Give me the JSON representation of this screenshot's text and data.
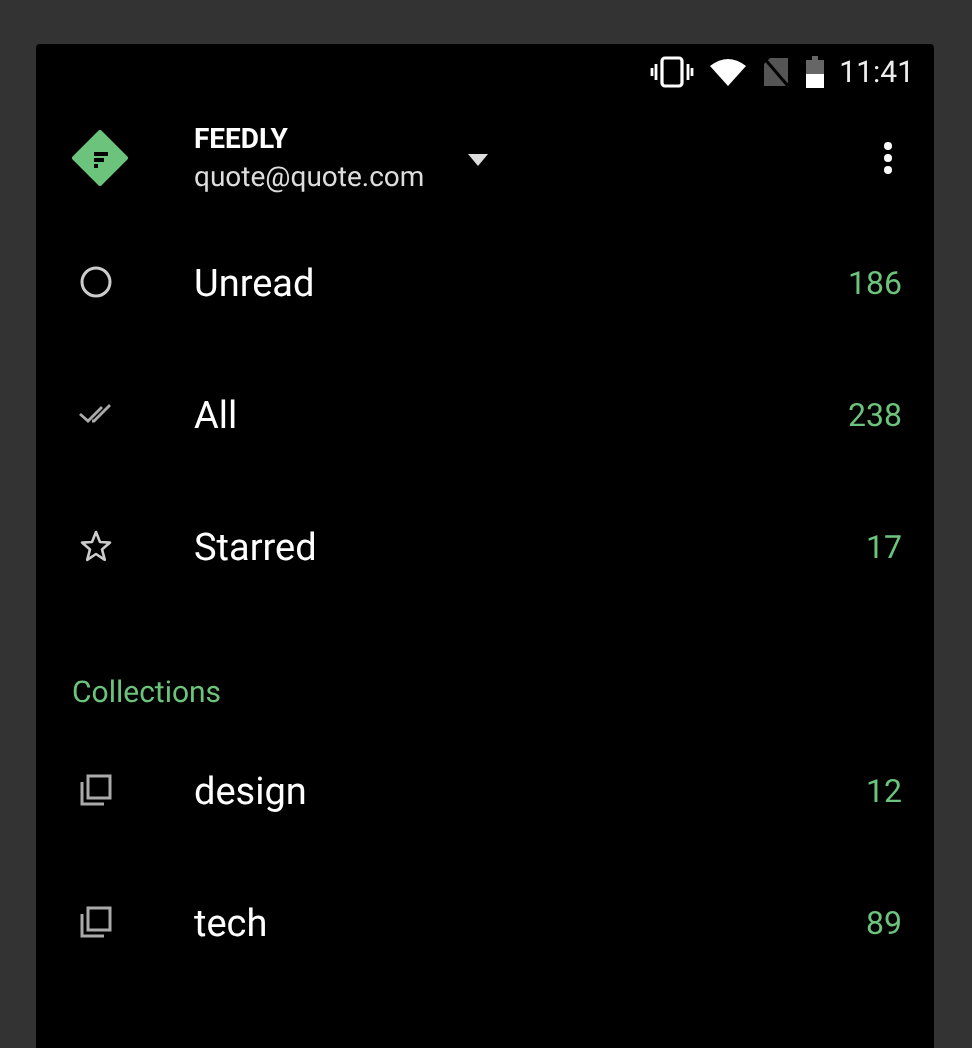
{
  "status_bar": {
    "time": "11:41"
  },
  "account": {
    "name": "FEEDLY",
    "email": "quote@quote.com"
  },
  "items": [
    {
      "kind": "unread",
      "label": "Unread",
      "count": "186"
    },
    {
      "kind": "all",
      "label": "All",
      "count": "238"
    },
    {
      "kind": "starred",
      "label": "Starred",
      "count": "17"
    }
  ],
  "collections": {
    "title": "Collections",
    "items": [
      {
        "kind": "collection",
        "label": "design",
        "count": "12"
      },
      {
        "kind": "collection",
        "label": "tech",
        "count": "89"
      }
    ]
  }
}
